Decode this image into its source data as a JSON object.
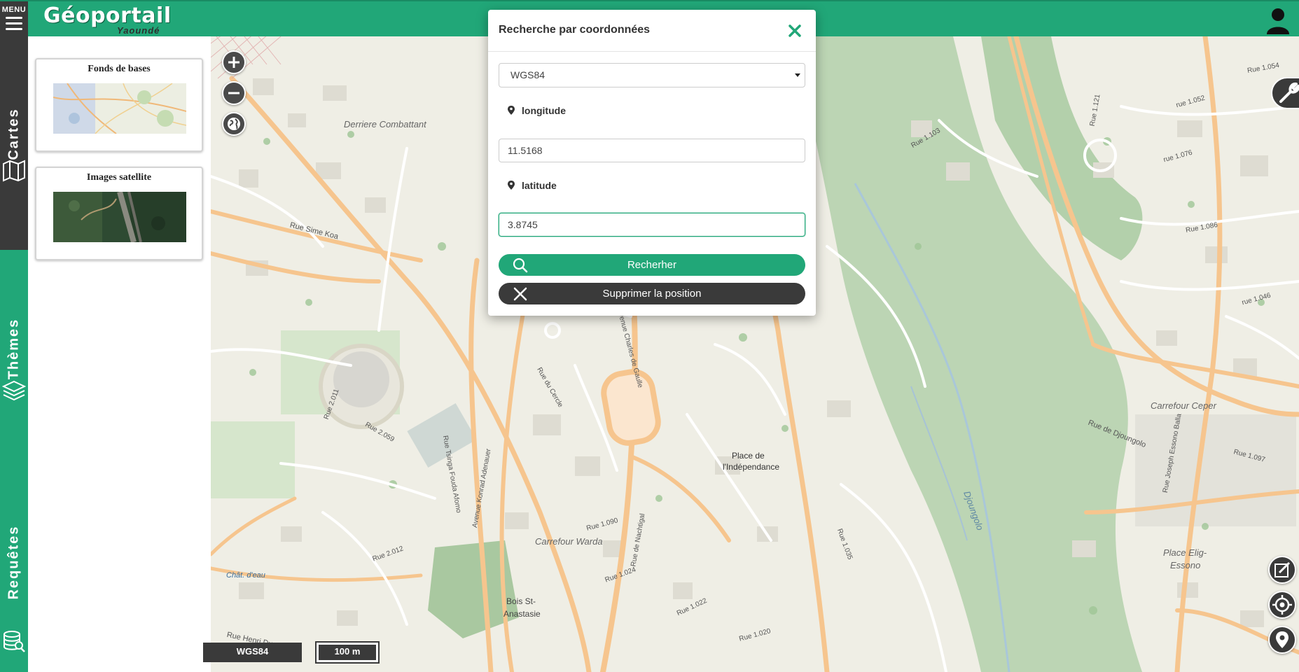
{
  "app": {
    "menu_label": "MENU",
    "logo_title": "Géoportail",
    "logo_subtitle": "Yaoundé"
  },
  "rail": {
    "tabs": [
      {
        "label": "Cartes",
        "icon": "map-icon"
      },
      {
        "label": "Thèmes",
        "icon": "layers-icon"
      },
      {
        "label": "Requêtes",
        "icon": "database-search-icon"
      }
    ]
  },
  "sidepanel": {
    "cards": [
      {
        "title": "Fonds de bases"
      },
      {
        "title": "Images satellite"
      }
    ]
  },
  "map": {
    "labels": {
      "derriere_combattant": "Derriere Combattant",
      "rue_sime_koa": "Rue Sime Koa",
      "place_independance_1": "Place de",
      "place_independance_2": "l'Indépendance",
      "carrefour_warda": "Carrefour Warda",
      "bois_1": "Bois St-",
      "bois_2": "Anastasie",
      "chat_eau_1": "Chât. d'eau",
      "carrefour_ceper": "Carrefour Ceper",
      "place_elig_1": "Place Elig-",
      "place_elig_2": "Essono",
      "djoungolo": "Djoungolo",
      "rue_de_djoungolo": "Rue de Djoungolo",
      "rue_henri_dunant": "Rue Henri Dunant",
      "rue_2011": "Rue 2.011",
      "rue_2059": "Rue 2.059",
      "rue_2012": "Rue 2.012",
      "rue_1090": "Rue 1.090",
      "rue_1024": "Rue 1.024",
      "rue_1022": "Rue 1.022",
      "rue_1020": "Rue 1.020",
      "rue_1035": "Rue 1.035",
      "rue_1103": "Rue 1.103",
      "rue_1086": "Rue 1.086",
      "rue_1076": "rue 1.076",
      "rue_1052": "rue 1.052",
      "rue_1054": "Rue 1.054",
      "rue_1097": "Rue 1.097",
      "rue_1046": "rue 1.046",
      "rue_1121": "Rue 1.121",
      "avenue_charles": "Avenue Charles de Gaulle",
      "rue_du_cercle": "Rue du Cercle",
      "rue_de_nachtigal": "Rue de Nachtigal",
      "rue_joseph": "Rue Joseph Essono Balla",
      "av_adenauer": "Avenue Konrad Adenauer",
      "rue_fouda": "Rue Tsinga Fouda Afomo"
    },
    "crs_label": "WGS84",
    "scale_label": "100 m"
  },
  "dialog": {
    "title": "Recherche par coordonnées",
    "crs_selected": "WGS84",
    "longitude_label": "longitude",
    "longitude_value": "11.5168",
    "latitude_label": "latitude",
    "latitude_value": "3.8745",
    "search_button": "Recherher",
    "clear_button": "Supprimer la position"
  },
  "colors": {
    "brand_green": "#21a778",
    "dark": "#3a3a3a",
    "map_background": "#efeee5",
    "road_orange": "#f5c48a",
    "forest": "#9cc39a"
  }
}
